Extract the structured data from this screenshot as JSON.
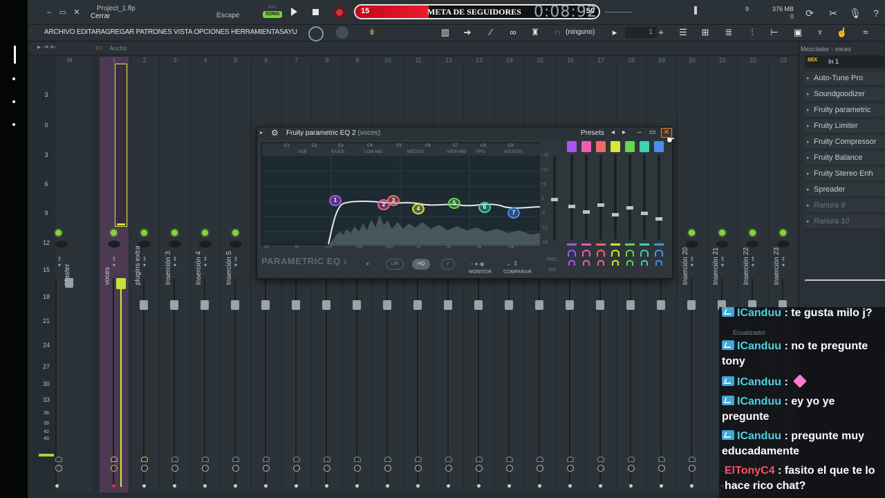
{
  "titlebar": {
    "file_name": "Project_1.flp",
    "close_label": "Cerrar",
    "escape_label": "Escape",
    "pat_label": "PAT",
    "song_label": "SONG"
  },
  "goal": {
    "current": "15",
    "label": "META DE SEGUIDORES",
    "target": "50",
    "progress": 0.3,
    "color": "#e01a2b"
  },
  "transport": {
    "time": "0:08:92",
    "monitor_value": "9",
    "memory": "376 MB",
    "memory_sub": "0"
  },
  "menu": {
    "text": "ARCHIVO EDITARAGREGAR PATRONES VISTA OPCIONES HERRAMIENTASAYU",
    "snap_label": "(ninguno)",
    "step_value": "1"
  },
  "mixer": {
    "width_label": "Ancho",
    "ruler": [
      "3",
      "0",
      "3",
      "6",
      "9",
      "12",
      "15",
      "18",
      "21",
      "24",
      "27",
      "30",
      "33",
      "36",
      "39",
      "42",
      "45"
    ],
    "tracks": [
      {
        "num": "M",
        "name": "Master"
      },
      {
        "num": "1",
        "name": "voces"
      },
      {
        "num": "2",
        "name": "plugins extra"
      },
      {
        "num": "3",
        "name": "Inserción 3"
      },
      {
        "num": "4",
        "name": "Inserción 4"
      },
      {
        "num": "5",
        "name": "Inserción 5"
      },
      {
        "num": "6",
        "name": ""
      },
      {
        "num": "7",
        "name": ""
      },
      {
        "num": "8",
        "name": ""
      },
      {
        "num": "9",
        "name": ""
      },
      {
        "num": "10",
        "name": ""
      },
      {
        "num": "11",
        "name": ""
      },
      {
        "num": "12",
        "name": ""
      },
      {
        "num": "13",
        "name": ""
      },
      {
        "num": "14",
        "name": ""
      },
      {
        "num": "15",
        "name": ""
      },
      {
        "num": "16",
        "name": ""
      },
      {
        "num": "17",
        "name": ""
      },
      {
        "num": "18",
        "name": ""
      },
      {
        "num": "19",
        "name": ""
      },
      {
        "num": "20",
        "name": "Inserción 20"
      },
      {
        "num": "21",
        "name": "Inserción 21"
      },
      {
        "num": "22",
        "name": "Inserción 22"
      },
      {
        "num": "23",
        "name": "Inserción 23"
      }
    ]
  },
  "eq": {
    "title": "Fruity parametric EQ 2",
    "subtitle": "(voces)",
    "presets_label": "Presets",
    "bands_top": [
      "C1",
      "C2",
      "C3",
      "C4",
      "C5",
      "C6",
      "C7",
      "C8",
      "C9"
    ],
    "bands_bottom": [
      "SUB",
      "BAJOS",
      "LOW MID",
      "MEDIOS",
      "HIGH MID",
      "PRS",
      "AGUDOS"
    ],
    "db_scale": [
      "+18",
      "+12",
      "+6",
      "0",
      "-6",
      "-12",
      "-18"
    ],
    "freq_scale": [
      "20",
      "50",
      "100",
      "200",
      "500",
      "1k",
      "2k",
      "5k",
      "10k"
    ],
    "brand": "PARAMETRIC EQ",
    "brand_version": "2",
    "lin_label": "LIN",
    "hq_label": "HQ",
    "monitor_label": "MONITOR",
    "compare_label": "COMPARAR",
    "freq_label": "FREC",
    "bw_label": "BW",
    "band_colors": [
      "#a855f7",
      "#ee5db4",
      "#ef6b6b",
      "#d8e53b",
      "#64d84a",
      "#3ed4b0",
      "#4a8ff0"
    ],
    "band_nodes": [
      "1",
      "2",
      "3",
      "4",
      "5",
      "6",
      "7"
    ]
  },
  "right_panel": {
    "title": "Mezclador - voces",
    "mix_label": "MIX",
    "input": "In 1",
    "slots": [
      {
        "name": "Auto-Tune Pro",
        "empty": false
      },
      {
        "name": "Soundgoodizer",
        "empty": false
      },
      {
        "name": "Fruity parametric",
        "empty": false
      },
      {
        "name": "Fruity Limiter",
        "empty": false
      },
      {
        "name": "Fruity Compressor",
        "empty": false
      },
      {
        "name": "Fruity Balance",
        "empty": false
      },
      {
        "name": "Fruity Stereo Enh",
        "empty": false
      },
      {
        "name": "Spreader",
        "empty": false
      },
      {
        "name": "Ranura 9",
        "empty": true
      },
      {
        "name": "Ranura 10",
        "empty": true
      }
    ],
    "eq_label": "Ecualizador"
  },
  "chat": {
    "messages": [
      {
        "user": "ICanduu",
        "text": " : te gusta milo j?",
        "alt": false
      },
      {
        "user": "ICanduu",
        "text": " : no te pregunte tony",
        "alt": false
      },
      {
        "user": "ICanduu",
        "text": " : ",
        "alt": false,
        "gem": true
      },
      {
        "user": "ICanduu",
        "text": " : ey yo ye pregunte",
        "alt": false
      },
      {
        "user": "ICanduu",
        "text": " : pregunte muy educadamente",
        "alt": false
      },
      {
        "user": "ElTonyC4",
        "text": " : fasito el que te lo hace rico chat?",
        "alt": true
      }
    ]
  }
}
